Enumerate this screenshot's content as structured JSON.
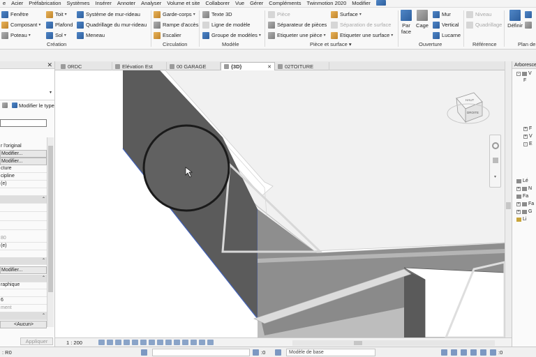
{
  "menu": [
    "e",
    "Acier",
    "Préfabrication",
    "Systèmes",
    "Insérer",
    "Annoter",
    "Analyser",
    "Volume et site",
    "Collaborer",
    "Vue",
    "Gérer",
    "Compléments",
    "Twinmotion 2020",
    "Modifier"
  ],
  "ribbon": {
    "creation": {
      "col1": [
        "Fenêtre",
        "Composant",
        "Poteau"
      ],
      "col2": [
        "Toit",
        "Plafond",
        "Sol"
      ],
      "col3": [
        "Système de mur-rideau",
        "Quadrillage du mur-rideau",
        "Meneau"
      ],
      "label": "Création"
    },
    "circulation": {
      "items": [
        "Garde-corps",
        "Rampe d'accès",
        "Escalier"
      ],
      "label": "Circulation"
    },
    "modele": {
      "items": [
        "Texte 3D",
        "Ligne de modèle",
        "Groupe de modèles"
      ],
      "label": "Modèle"
    },
    "piece": {
      "col1": [
        "Pièce",
        "Séparateur de pièces",
        "Etiqueter  une pièce"
      ],
      "col2": [
        "Surface",
        "Séparation de surface",
        "Etiqueter  une surface"
      ],
      "label": "Pièce et surface"
    },
    "ouverture": {
      "parface": "Par face",
      "cage": "Cage",
      "items": [
        "Mur",
        "Vertical",
        "Lucarne"
      ],
      "label": "Ouverture"
    },
    "reference": {
      "items": [
        "Niveau",
        "Quadrillage"
      ],
      "label": "Référence"
    },
    "travail": {
      "definir": "Définir",
      "label": "Plan de t"
    }
  },
  "properties": {
    "edit_type": "Modifier le type",
    "rows": [
      "",
      "r l'original",
      "Modifier...",
      "Modifier...",
      "cture",
      "cipline",
      "(e)",
      "",
      "",
      "",
      "",
      "",
      "80",
      "(e)",
      "",
      "Modifier...",
      "",
      "raphique",
      "",
      "6",
      "ment",
      "",
      "<Aucun>"
    ],
    "apply": "Appliquer"
  },
  "tabs": [
    {
      "label": "0RDC",
      "active": false
    },
    {
      "label": "Elévation Est",
      "active": false
    },
    {
      "label": "00 GARAGE",
      "active": false
    },
    {
      "label": "{3D}",
      "active": true
    },
    {
      "label": "02TOITURE",
      "active": false
    }
  ],
  "viewcube": {
    "top": "HAUT",
    "face": "DROITE"
  },
  "browser": {
    "title": "Arboresce",
    "items": [
      "V",
      "F",
      "",
      "",
      "",
      "F",
      "V",
      "E",
      "",
      "Lé",
      "N",
      "Fa",
      "Fa",
      "G",
      "Li"
    ]
  },
  "viewctrl": {
    "scale": "1 : 200"
  },
  "status": {
    "text": ": R0",
    "zero1": ":0",
    "model": "Modèle de base",
    "zero2": ":0"
  }
}
